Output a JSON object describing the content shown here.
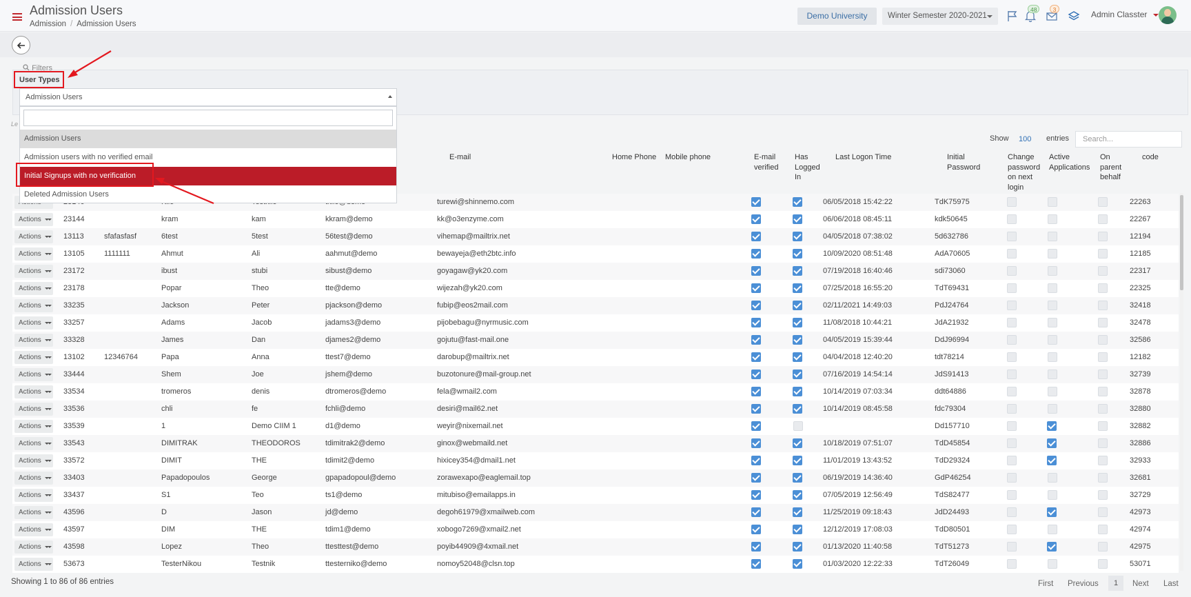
{
  "header": {
    "title": "Admission Users",
    "breadcrumb": [
      "Admission",
      "Admission Users"
    ],
    "university": "Demo University",
    "semester": "Winter Semester 2020-2021",
    "notif_count": "48",
    "mail_count": "3",
    "user_name": "Admin Classter",
    "icons": [
      "flag-icon",
      "bell-icon",
      "mail-icon",
      "layers-icon"
    ]
  },
  "filters": {
    "label": "Filters",
    "user_types_label": "User Types",
    "select_value": "Admission Users",
    "options": [
      "Admission Users",
      "Admission users with no verified email",
      "Initial Signups with no verification",
      "Deleted Admission Users"
    ],
    "selected_index": 0,
    "highlighted_index": 2
  },
  "table": {
    "show_label": "Show",
    "show_value": "100",
    "entries_label": "entries",
    "search_placeholder": "Search...",
    "length_label": "Le",
    "columns": [
      "E-mail",
      "Home Phone",
      "Mobile phone",
      "E-mail verified",
      "Has Logged In",
      "Last Logon Time",
      "Initial Password",
      "Change password on next login",
      "Active Applications",
      "On parent behalf",
      "code"
    ],
    "action_label": "Actions",
    "rows": [
      {
        "id": "23140",
        "phone": "",
        "last": "Kilo",
        "first": "Testkilo",
        "user": "tkilo@demo",
        "email": "turewi@shinnemo.com",
        "ev": true,
        "li": true,
        "logon": "06/05/2018 15:42:22",
        "pwd": "TdK75975",
        "cp": false,
        "aa": false,
        "pb": false,
        "code": "22263"
      },
      {
        "id": "23144",
        "phone": "",
        "last": "kram",
        "first": "kam",
        "user": "kkram@demo",
        "email": "kk@o3enzyme.com",
        "ev": true,
        "li": true,
        "logon": "06/06/2018 08:45:11",
        "pwd": "kdk50645",
        "cp": false,
        "aa": false,
        "pb": false,
        "code": "22267"
      },
      {
        "id": "13113",
        "phone": "sfafasfasf",
        "last": "6test",
        "first": "5test",
        "user": "56test@demo",
        "email": "vihemap@mailtrix.net",
        "ev": true,
        "li": true,
        "logon": "04/05/2018 07:38:02",
        "pwd": "5d632786",
        "cp": false,
        "aa": false,
        "pb": false,
        "code": "12194"
      },
      {
        "id": "13105",
        "phone": "1111111",
        "last": "Ahmut",
        "first": "Ali",
        "user": "aahmut@demo",
        "email": "bewayeja@eth2btc.info",
        "ev": true,
        "li": true,
        "logon": "10/09/2020 08:51:48",
        "pwd": "AdA70605",
        "cp": false,
        "aa": false,
        "pb": false,
        "code": "12185"
      },
      {
        "id": "23172",
        "phone": "",
        "last": "ibust",
        "first": "stubi",
        "user": "sibust@demo",
        "email": "goyagaw@yk20.com",
        "ev": true,
        "li": true,
        "logon": "07/19/2018 16:40:46",
        "pwd": "sdi73060",
        "cp": false,
        "aa": false,
        "pb": false,
        "code": "22317"
      },
      {
        "id": "23178",
        "phone": "",
        "last": "Popar",
        "first": "Theo",
        "user": "tte@demo",
        "email": "wijezah@yk20.com",
        "ev": true,
        "li": true,
        "logon": "07/25/2018 16:55:20",
        "pwd": "TdT69431",
        "cp": false,
        "aa": false,
        "pb": false,
        "code": "22325"
      },
      {
        "id": "33235",
        "phone": "",
        "last": "Jackson",
        "first": "Peter",
        "user": "pjackson@demo",
        "email": "fubip@eos2mail.com",
        "ev": true,
        "li": true,
        "logon": "02/11/2021 14:49:03",
        "pwd": "PdJ24764",
        "cp": false,
        "aa": false,
        "pb": false,
        "code": "32418"
      },
      {
        "id": "33257",
        "phone": "",
        "last": "Adams",
        "first": "Jacob",
        "user": "jadams3@demo",
        "email": "pijobebagu@nyrmusic.com",
        "ev": true,
        "li": true,
        "logon": "11/08/2018 10:44:21",
        "pwd": "JdA21932",
        "cp": false,
        "aa": false,
        "pb": false,
        "code": "32478"
      },
      {
        "id": "33328",
        "phone": "",
        "last": "James",
        "first": "Dan",
        "user": "djames2@demo",
        "email": "gojutu@fast-mail.one",
        "ev": true,
        "li": true,
        "logon": "04/05/2019 15:39:44",
        "pwd": "DdJ96994",
        "cp": false,
        "aa": false,
        "pb": false,
        "code": "32586"
      },
      {
        "id": "13102",
        "phone": "12346764",
        "last": "Papa",
        "first": "Anna",
        "user": "ttest7@demo",
        "email": "darobup@mailtrix.net",
        "ev": true,
        "li": true,
        "logon": "04/04/2018 12:40:20",
        "pwd": "tdt78214",
        "cp": false,
        "aa": false,
        "pb": false,
        "code": "12182"
      },
      {
        "id": "33444",
        "phone": "",
        "last": "Shem",
        "first": "Joe",
        "user": "jshem@demo",
        "email": "buzotonure@mail-group.net",
        "ev": true,
        "li": true,
        "logon": "07/16/2019 14:54:14",
        "pwd": "JdS91413",
        "cp": false,
        "aa": false,
        "pb": false,
        "code": "32739"
      },
      {
        "id": "33534",
        "phone": "",
        "last": "tromeros",
        "first": "denis",
        "user": "dtromeros@demo",
        "email": "fela@wmail2.com",
        "ev": true,
        "li": true,
        "logon": "10/14/2019 07:03:34",
        "pwd": "ddt64886",
        "cp": false,
        "aa": false,
        "pb": false,
        "code": "32878"
      },
      {
        "id": "33536",
        "phone": "",
        "last": "chli",
        "first": "fe",
        "user": "fchli@demo",
        "email": "desiri@mail62.net",
        "ev": true,
        "li": true,
        "logon": "10/14/2019 08:45:58",
        "pwd": "fdc79304",
        "cp": false,
        "aa": false,
        "pb": false,
        "code": "32880"
      },
      {
        "id": "33539",
        "phone": "",
        "last": "1",
        "first": "Demo CIIM 1",
        "user": "d1@demo",
        "email": "weyir@nixemail.net",
        "ev": true,
        "li": false,
        "logon": "",
        "pwd": "Dd157710",
        "cp": false,
        "aa": true,
        "pb": false,
        "code": "32882"
      },
      {
        "id": "33543",
        "phone": "",
        "last": "DIMITRAK",
        "first": "THEODOROS",
        "user": "tdimitrak2@demo",
        "email": "ginox@webmaild.net",
        "ev": true,
        "li": true,
        "logon": "10/18/2019 07:51:07",
        "pwd": "TdD45854",
        "cp": false,
        "aa": true,
        "pb": false,
        "code": "32886"
      },
      {
        "id": "33572",
        "phone": "",
        "last": "DIMIT",
        "first": "THE",
        "user": "tdimit2@demo",
        "email": "hixicey354@dmail1.net",
        "ev": true,
        "li": true,
        "logon": "11/01/2019 13:43:52",
        "pwd": "TdD29324",
        "cp": false,
        "aa": true,
        "pb": false,
        "code": "32933"
      },
      {
        "id": "33403",
        "phone": "",
        "last": "Papadopoulos",
        "first": "George",
        "user": "gpapadopoul@demo",
        "email": "zorawexapo@eaglemail.top",
        "ev": true,
        "li": true,
        "logon": "06/19/2019 14:36:40",
        "pwd": "GdP46254",
        "cp": false,
        "aa": false,
        "pb": false,
        "code": "32681"
      },
      {
        "id": "33437",
        "phone": "",
        "last": "S1",
        "first": "Teo",
        "user": "ts1@demo",
        "email": "mitubiso@emailapps.in",
        "ev": true,
        "li": true,
        "logon": "07/05/2019 12:56:49",
        "pwd": "TdS82477",
        "cp": false,
        "aa": false,
        "pb": false,
        "code": "32729"
      },
      {
        "id": "43596",
        "phone": "",
        "last": "D",
        "first": "Jason",
        "user": "jd@demo",
        "email": "degoh61979@xmailweb.com",
        "ev": true,
        "li": true,
        "logon": "11/25/2019 09:18:43",
        "pwd": "JdD24493",
        "cp": false,
        "aa": true,
        "pb": false,
        "code": "42973"
      },
      {
        "id": "43597",
        "phone": "",
        "last": "DIM",
        "first": "THE",
        "user": "tdim1@demo",
        "email": "xobogo7269@xmail2.net",
        "ev": true,
        "li": true,
        "logon": "12/12/2019 17:08:03",
        "pwd": "TdD80501",
        "cp": false,
        "aa": false,
        "pb": false,
        "code": "42974"
      },
      {
        "id": "43598",
        "phone": "",
        "last": "Lopez",
        "first": "Theo",
        "user": "ttesttest@demo",
        "email": "poyib44909@4xmail.net",
        "ev": true,
        "li": true,
        "logon": "01/13/2020 11:40:58",
        "pwd": "TdT51273",
        "cp": false,
        "aa": true,
        "pb": false,
        "code": "42975"
      },
      {
        "id": "53673",
        "phone": "",
        "last": "TesterNikou",
        "first": "Testnik",
        "user": "ttesterniko@demo",
        "email": "nomoy52048@clsn.top",
        "ev": true,
        "li": true,
        "logon": "01/03/2020 12:22:33",
        "pwd": "TdT26049",
        "cp": false,
        "aa": false,
        "pb": false,
        "code": "53071"
      }
    ]
  },
  "footer": {
    "showing": "Showing 1 to 86 of 86 entries",
    "first": "First",
    "previous": "Previous",
    "current_page": "1",
    "next": "Next",
    "last": "Last"
  },
  "colors": {
    "accent_red": "#bb1c28",
    "annotation_red": "#e3181f",
    "checkbox_blue": "#4b8fd6",
    "link_blue": "#2f6fb5"
  }
}
